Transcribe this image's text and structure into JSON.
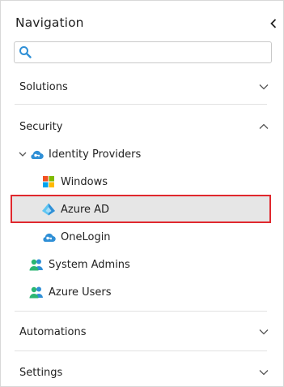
{
  "header": {
    "title": "Navigation"
  },
  "search": {
    "value": "",
    "placeholder": ""
  },
  "sections": {
    "solutions": "Solutions",
    "security": "Security",
    "automations": "Automations",
    "settings": "Settings"
  },
  "tree": {
    "identity_providers": "Identity Providers",
    "windows": "Windows",
    "azure_ad": "Azure AD",
    "onelogin": "OneLogin",
    "system_admins": "System Admins",
    "azure_users": "Azure Users"
  },
  "colors": {
    "accent_blue": "#2f8fd6",
    "selection_border": "#e0282e",
    "users_green": "#2bb673"
  },
  "icons": {
    "collapse": "chevron-left-icon",
    "search": "search-icon",
    "identity": "cloud-key-icon",
    "windows": "windows-logo-icon",
    "azure": "azure-ad-icon",
    "onelogin": "cloud-key-icon",
    "users": "users-icon"
  }
}
